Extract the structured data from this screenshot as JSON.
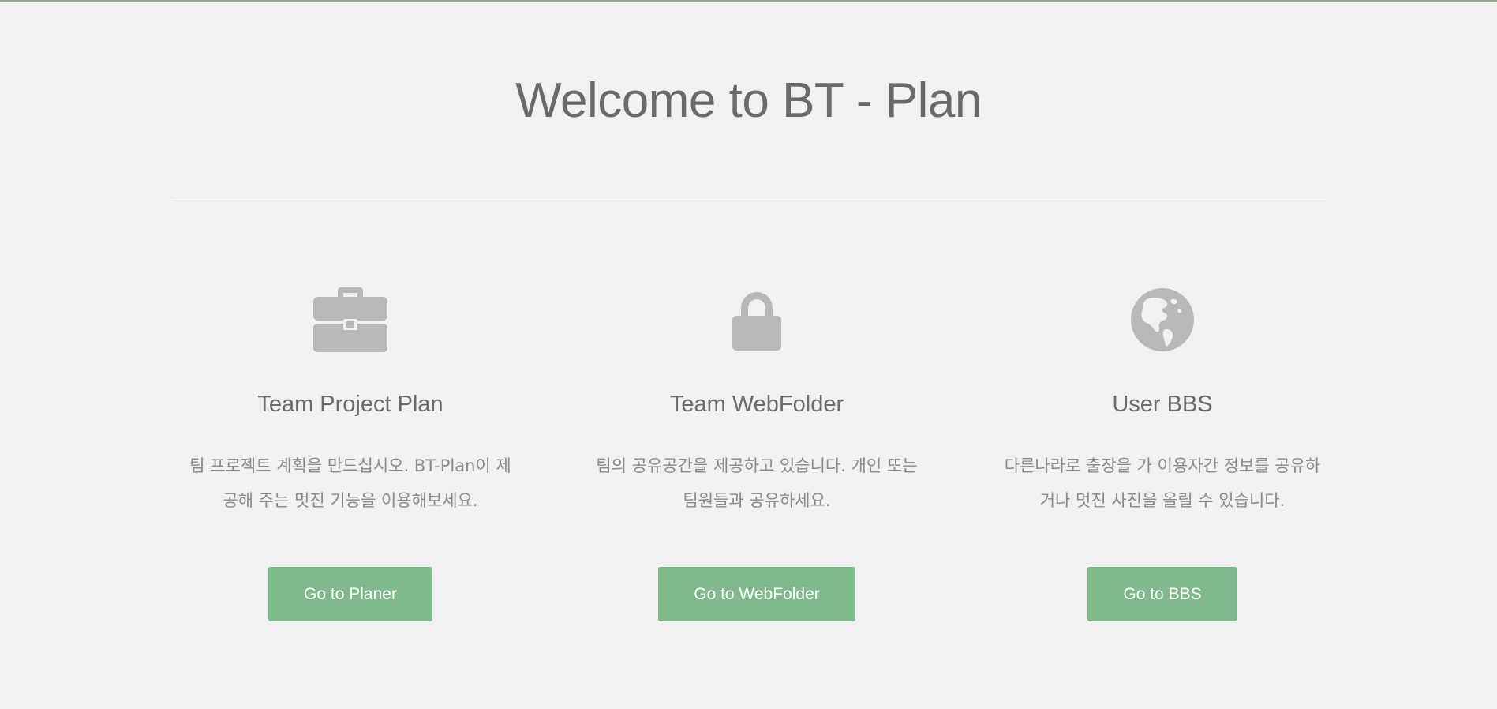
{
  "page": {
    "title": "Welcome to BT - Plan",
    "accent_color": "#80b98c"
  },
  "features": [
    {
      "icon": "briefcase-icon",
      "heading": "Team Project Plan",
      "desc_line1": "팀 프로젝트 계획을 만드십시오. BT-Plan이 제",
      "desc_line2": "공해 주는 멋진 기능을 이용해보세요.",
      "button": "Go to Planer"
    },
    {
      "icon": "lock-icon",
      "heading": "Team WebFolder",
      "desc_line1": "팀의 공유공간을 제공하고 있습니다. 개인 또는",
      "desc_line2": "팀원들과 공유하세요.",
      "button": "Go to WebFolder"
    },
    {
      "icon": "globe-icon",
      "heading": "User BBS",
      "desc_line1": "다른나라로 출장을 가 이용자간 정보를 공유하",
      "desc_line2": "거나 멋진 사진을 올릴 수 있습니다.",
      "button": "Go to BBS"
    }
  ]
}
